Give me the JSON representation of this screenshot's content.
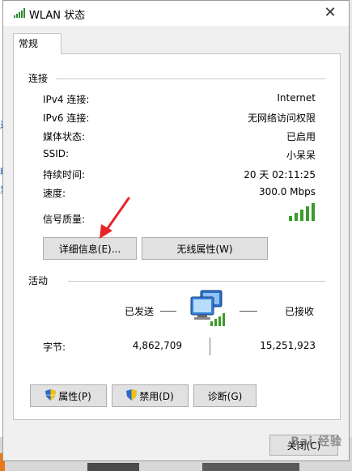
{
  "window": {
    "title": "WLAN 状态"
  },
  "tabs": [
    {
      "label": "常规"
    }
  ],
  "connection": {
    "section_label": "连接",
    "rows": [
      {
        "label": "IPv4 连接:",
        "value": "Internet"
      },
      {
        "label": "IPv6 连接:",
        "value": "无网络访问权限"
      },
      {
        "label": "媒体状态:",
        "value": "已启用"
      },
      {
        "label": "SSID:",
        "value": "小呆呆"
      },
      {
        "label": "持续时间:",
        "value": "20 天 02:11:25"
      },
      {
        "label": "速度:",
        "value": "300.0 Mbps"
      }
    ],
    "signal_label": "信号质量:",
    "signal_bars": 5,
    "details_button": "详细信息(E)...",
    "wireless_button": "无线属性(W)"
  },
  "activity": {
    "section_label": "活动",
    "sent_label": "已发送",
    "received_label": "已接收",
    "bytes_label": "字节:",
    "bytes_sent": "4,862,709",
    "bytes_received": "15,251,923"
  },
  "buttons": {
    "properties": "属性(P)",
    "disable": "禁用(D)",
    "diagnose": "诊断(G)",
    "close": "关闭(C)"
  },
  "background_left_texts": [
    "连",
    "略",
    "复"
  ],
  "watermark": "Bai 经验",
  "colors": {
    "accent_arrow": "#e8242a",
    "signal_green": "#3a9a2a",
    "link_blue": "#1a5fb4"
  }
}
